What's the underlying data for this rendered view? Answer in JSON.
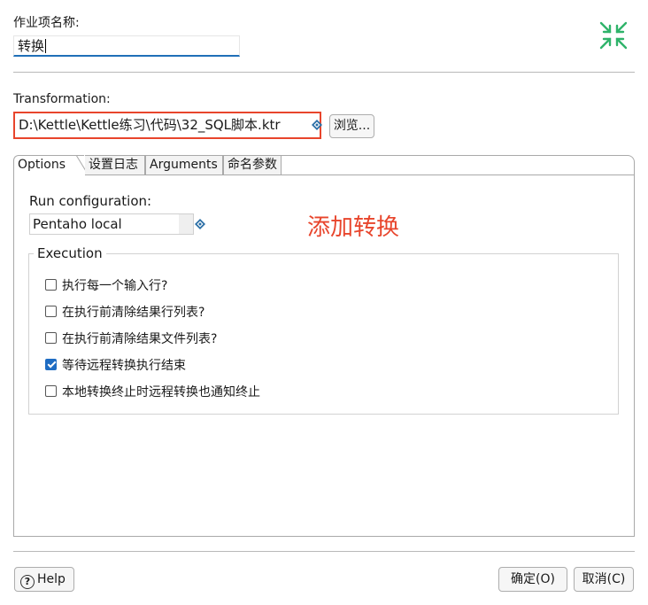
{
  "job_entry": {
    "name_label": "作业项名称:",
    "name_value": "转换"
  },
  "transformation": {
    "label": "Transformation:",
    "path_value": "D:\\Kettle\\Kettle练习\\代码\\32_SQL脚本.ktr",
    "browse_label": "浏览..."
  },
  "tabs": [
    {
      "label": "Options",
      "active": true
    },
    {
      "label": "设置日志",
      "active": false
    },
    {
      "label": "Arguments",
      "active": false
    },
    {
      "label": "命名参数",
      "active": false
    }
  ],
  "options": {
    "run_config_label": "Run configuration:",
    "run_config_value": "Pentaho local",
    "execution_legend": "Execution",
    "checkboxes": [
      {
        "label": "执行每一个输入行?",
        "checked": false
      },
      {
        "label": "在执行前清除结果行列表?",
        "checked": false
      },
      {
        "label": "在执行前清除结果文件列表?",
        "checked": false
      },
      {
        "label": "等待远程转换执行结束",
        "checked": true
      },
      {
        "label": "本地转换终止时远程转换也通知终止",
        "checked": false
      }
    ]
  },
  "annotation_text": "添加转换",
  "footer": {
    "help_label": "Help",
    "ok_label": "确定(O)",
    "cancel_label": "取消(C)"
  },
  "colors": {
    "accent_blue": "#1e6cc3",
    "highlight_red": "#e8452c",
    "collapse_icon_green": "#2fb36a"
  },
  "icons": {
    "collapse": "collapse-arrows-icon",
    "variable": "variable-diamond-icon",
    "help": "help-circle-icon"
  }
}
